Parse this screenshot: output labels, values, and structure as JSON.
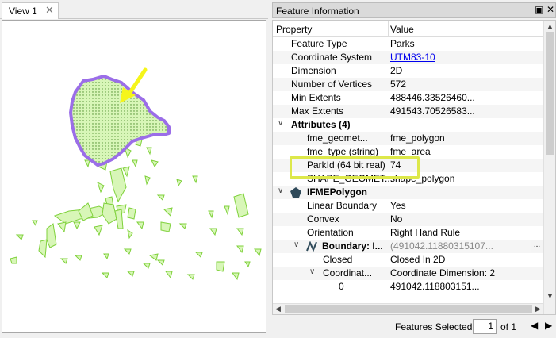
{
  "view": {
    "tab_label": "View 1",
    "close_glyph": "✕",
    "annotation_arrow_color": "#f5f51a",
    "feature_fill_color": "#d5f5b0",
    "feature_outline_color": "#9b6ee8",
    "other_features_color": "#7fd13b"
  },
  "panel": {
    "title": "Feature Information",
    "float_glyph": "▣",
    "close_glyph": "✕",
    "header": {
      "property": "Property",
      "value": "Value"
    },
    "rows": [
      {
        "property": "Feature Type",
        "value": "Parks"
      },
      {
        "property": "Coordinate System",
        "value": "UTM83-10"
      },
      {
        "property": "Dimension",
        "value": "2D"
      },
      {
        "property": "Number of Vertices",
        "value": "572"
      },
      {
        "property": "Min Extents",
        "value": "488446.33526460..."
      },
      {
        "property": "Max Extents",
        "value": "491543.70526583..."
      },
      {
        "property": "Attributes (4)",
        "value": ""
      },
      {
        "property": "fme_geomet...",
        "value": "fme_polygon"
      },
      {
        "property": "fme_type (string)",
        "value": "fme_area"
      },
      {
        "property": "ParkId (64 bit real)",
        "value": "74"
      },
      {
        "property": "SHAPE_GEOMET...",
        "value": "shape_polygon"
      },
      {
        "property": "IFMEPolygon",
        "value": ""
      },
      {
        "property": "Linear Boundary",
        "value": "Yes"
      },
      {
        "property": "Convex",
        "value": "No"
      },
      {
        "property": "Orientation",
        "value": "Right Hand Rule"
      },
      {
        "property": "Boundary: I...",
        "value": "(491042.11880315107..."
      },
      {
        "property": "Closed",
        "value": "Closed In 2D"
      },
      {
        "property": "Coordinat...",
        "value": "Coordinate Dimension: 2"
      },
      {
        "property": "0",
        "value": "491042.118803151..."
      }
    ],
    "ellipsis_label": "...",
    "highlight_color": "#dde84a"
  },
  "footer": {
    "features_selected_label": "Features Selected:",
    "current": "1",
    "of_label": "of 1"
  }
}
